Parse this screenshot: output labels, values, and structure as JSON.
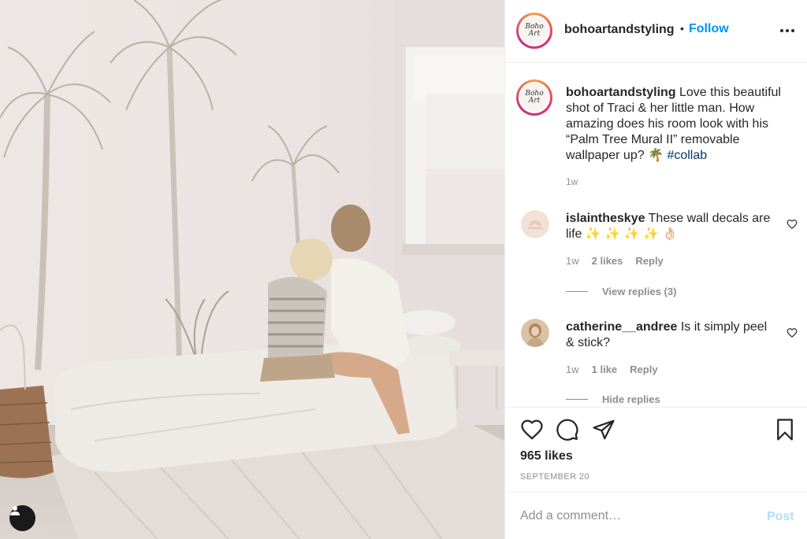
{
  "photo": {
    "description_icon": "user-tag-icon"
  },
  "header": {
    "username": "bohoartandstyling",
    "dot": "•",
    "follow_label": "Follow",
    "avatar_text_line1": "Boho",
    "avatar_text_line2": "Art",
    "more_icon": "more-horizontal-icon"
  },
  "caption": {
    "username": "bohoartandstyling",
    "text": " Love this beautiful shot of Traci & her little man. How amazing does his room look with his “Palm Tree Mural II” removable wallpaper up? 🌴 ",
    "hashtag": "#collab",
    "time": "1w"
  },
  "comments": [
    {
      "username": "islaintheskye",
      "text": " These wall decals are life ✨ ✨ ✨ ✨ 👌🏻",
      "time": "1w",
      "likes": "2 likes",
      "reply_label": "Reply",
      "replies_toggle": "View replies (3)"
    },
    {
      "username": "catherine__andree",
      "text": " Is it simply peel & stick?",
      "time": "1w",
      "likes": "1 like",
      "reply_label": "Reply",
      "replies_toggle": "Hide replies"
    }
  ],
  "actions": {
    "likes": "965 likes",
    "date": "SEPTEMBER 20",
    "icons": [
      "heart-icon",
      "comment-icon",
      "share-icon",
      "bookmark-icon"
    ]
  },
  "add_comment": {
    "placeholder": "Add a comment…",
    "post_label": "Post"
  },
  "colors": {
    "accent": "#0095f6",
    "hashtag": "#00376b",
    "muted": "#8e8e8e",
    "post_disabled": "#b2dffc"
  }
}
